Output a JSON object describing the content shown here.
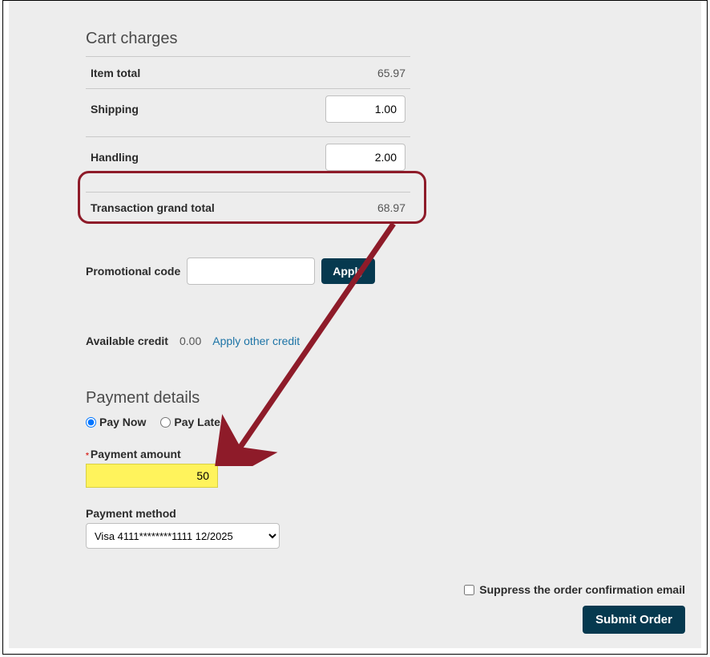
{
  "cart": {
    "title": "Cart charges",
    "item_total_label": "Item total",
    "item_total_value": "65.97",
    "shipping_label": "Shipping",
    "shipping_value": "1.00",
    "handling_label": "Handling",
    "handling_value": "2.00",
    "grand_total_label": "Transaction grand total",
    "grand_total_value": "68.97"
  },
  "promo": {
    "label": "Promotional code",
    "value": "",
    "apply_label": "Apply"
  },
  "credit": {
    "label": "Available credit",
    "value": "0.00",
    "apply_other_label": "Apply other credit"
  },
  "payment": {
    "title": "Payment details",
    "pay_now_label": "Pay Now",
    "pay_later_label": "Pay Later",
    "amount_label": "Payment amount",
    "amount_value": "50",
    "method_label": "Payment method",
    "method_selected": "Visa 4111********1111 12/2025"
  },
  "footer": {
    "suppress_label": "Suppress the order confirmation email",
    "submit_label": "Submit Order"
  }
}
